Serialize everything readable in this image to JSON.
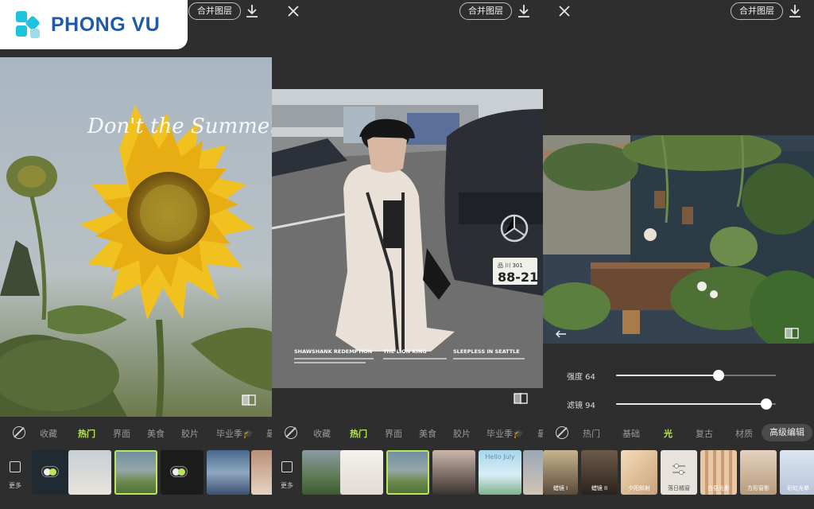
{
  "brand": {
    "name": "PHONG VU"
  },
  "panel1": {
    "merge_label": "合并图层",
    "photo_script": "Don't the Summer time",
    "categories": [
      "收藏",
      "热门",
      "界面",
      "美食",
      "胶片",
      "毕业季🎓",
      "最"
    ],
    "active_category": "热门",
    "more_label": "更多"
  },
  "panel2": {
    "merge_label": "合并图层",
    "poster": {
      "credits": [
        "SHAWSHANK REDEMPTION",
        "THE LION KING",
        "SLEEPLESS IN SEATTLE"
      ],
      "plate_top": "品 川 301",
      "plate_bottom": "88-21"
    },
    "categories": [
      "收藏",
      "热门",
      "界面",
      "美食",
      "胶片",
      "毕业季🎓",
      "最"
    ],
    "active_category": "热门",
    "more_label": "更多",
    "thumb_caption": "Hello July"
  },
  "panel3": {
    "merge_label": "合并图层",
    "sliders": [
      {
        "label": "强度 64",
        "value": 0.64
      },
      {
        "label": "滤镜 94",
        "value": 0.94
      }
    ],
    "categories": [
      "热门",
      "基础",
      "光",
      "复古",
      "材质"
    ],
    "active_category": "光",
    "advanced_label": "高级编辑",
    "thumbs": [
      "蜡镜 I",
      "蜡镜 II",
      "夕阳斜射",
      "落日橘窗",
      "白昼光影",
      "方形窗影",
      "彩虹光晕"
    ]
  },
  "colors": {
    "accent": "#b8e65a",
    "background": "#2e2e2e",
    "brand_blue": "#1f5aa8",
    "brand_cyan": "#1ec3e0"
  },
  "icons": [
    "close-icon",
    "download-icon",
    "compare-icon",
    "no-filter-icon",
    "more-icon",
    "undo-icon",
    "toggle-icon",
    "sliders-icon"
  ]
}
